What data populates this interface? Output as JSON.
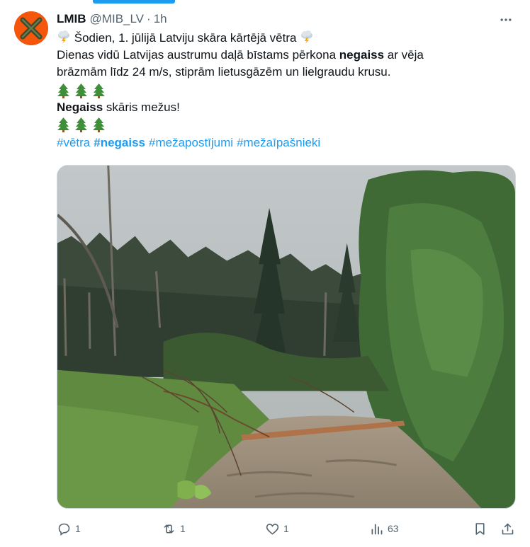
{
  "tweet": {
    "author_name": "LMIB",
    "handle": "@MIB_LV",
    "separator": "·",
    "time": "1h",
    "line1": "Šodien, 1. jūlijā Latviju skāra kārtējā vētra",
    "line2_pre": "Dienas vidū Latvijas austrumu daļā bīstams pērkona ",
    "line2_bold": "negaiss",
    "line2_post": " ar vēja",
    "line3": "brāzmām līdz 24 m/s, stiprām lietusgāzēm un lielgraudu krusu.",
    "line4_bold": "Negaiss",
    "line4_post": " skāris mežus!",
    "hashtags": [
      "#vētra",
      "#negaiss",
      "#mežapostījumi",
      "#mežaīpašnieki"
    ],
    "icons": {
      "weather": "thunder-cloud-icon",
      "tree": "evergreen-tree-icon"
    }
  },
  "actions": {
    "reply_count": "1",
    "retweet_count": "1",
    "like_count": "1",
    "views_count": "63"
  },
  "colors": {
    "accent": "#1d9bf0",
    "avatar_bg": "#f4560c",
    "muted_text": "#536471"
  }
}
